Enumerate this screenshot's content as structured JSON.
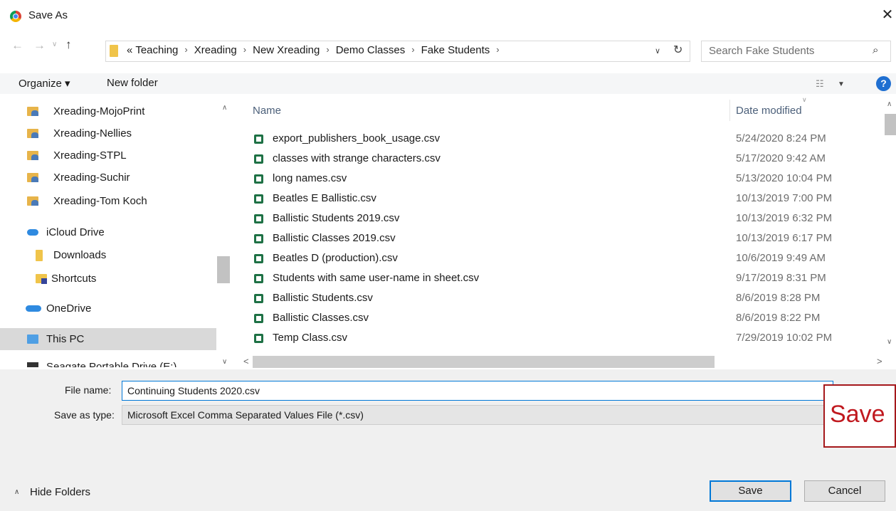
{
  "window": {
    "title": "Save As",
    "close_glyph": "✕"
  },
  "nav": {
    "back_glyph": "←",
    "forward_glyph": "→",
    "recent_glyph": "∨",
    "up_glyph": "↑",
    "address_prefix": "«",
    "breadcrumbs": [
      "Teaching",
      "Xreading",
      "New Xreading",
      "Demo Classes",
      "Fake Students"
    ],
    "crumb_separator": "›",
    "dropdown_glyph": "∨",
    "refresh_glyph": "↻",
    "search_placeholder": "Search Fake Students",
    "search_glyph": "⌕"
  },
  "toolbar": {
    "organize_label": "Organize ▾",
    "new_folder_label": "New folder",
    "view_glyph": "☷",
    "view_caret": "▼",
    "help_glyph": "?"
  },
  "sidebar": {
    "items": [
      {
        "label": "Xreading-MojoPrint",
        "icon": "shared-folder-icon"
      },
      {
        "label": "Xreading-Nellies",
        "icon": "shared-folder-icon"
      },
      {
        "label": "Xreading-STPL",
        "icon": "shared-folder-icon"
      },
      {
        "label": "Xreading-Suchir",
        "icon": "shared-folder-icon"
      },
      {
        "label": "Xreading-Tom Koch",
        "icon": "shared-folder-icon"
      },
      {
        "label": "iCloud Drive",
        "icon": "cloud-icon"
      },
      {
        "label": "Downloads",
        "icon": "folder-icon"
      },
      {
        "label": "Shortcuts",
        "icon": "shortcut-folder-icon"
      },
      {
        "label": "OneDrive",
        "icon": "cloud-icon"
      },
      {
        "label": "This PC",
        "icon": "computer-icon"
      },
      {
        "label": "Seagate Portable Drive (E:)",
        "icon": "drive-icon"
      }
    ],
    "selected": "This PC"
  },
  "files": {
    "columns": {
      "name": "Name",
      "date": "Date modified",
      "sort_glyph": "∨"
    },
    "rows": [
      {
        "name": "export_publishers_book_usage.csv",
        "date": "5/24/2020 8:24 PM"
      },
      {
        "name": "classes with strange characters.csv",
        "date": "5/17/2020 9:42 AM"
      },
      {
        "name": "long names.csv",
        "date": "5/13/2020 10:04 PM"
      },
      {
        "name": "Beatles E Ballistic.csv",
        "date": "10/13/2019 7:00 PM"
      },
      {
        "name": "Ballistic Students 2019.csv",
        "date": "10/13/2019 6:32 PM"
      },
      {
        "name": "Ballistic Classes 2019.csv",
        "date": "10/13/2019 6:17 PM"
      },
      {
        "name": "Beatles D (production).csv",
        "date": "10/6/2019 9:49 AM"
      },
      {
        "name": "Students with same user-name in sheet.csv",
        "date": "9/17/2019 8:31 PM"
      },
      {
        "name": "Ballistic Students.csv",
        "date": "8/6/2019 8:28 PM"
      },
      {
        "name": "Ballistic Classes.csv",
        "date": "8/6/2019 8:22 PM"
      },
      {
        "name": "Temp Class.csv",
        "date": "7/29/2019 10:02 PM"
      }
    ],
    "file_icon": "excel-csv-icon"
  },
  "form": {
    "file_name_label": "File name:",
    "file_name_value": "Continuing Students 2020.csv",
    "save_type_label": "Save as type:",
    "save_type_value": "Microsoft Excel Comma Separated Values File (*.csv)",
    "callout_text": "Save"
  },
  "footer": {
    "hide_folders_label": "Hide Folders",
    "hide_caret": "∧",
    "save_button": "Save",
    "cancel_button": "Cancel"
  },
  "scroll": {
    "up": "∧",
    "down": "∨",
    "left": "<",
    "right": ">"
  },
  "colors": {
    "accent": "#0078d7",
    "callout": "#c0191f",
    "selected_row": "#d9d9d9"
  }
}
